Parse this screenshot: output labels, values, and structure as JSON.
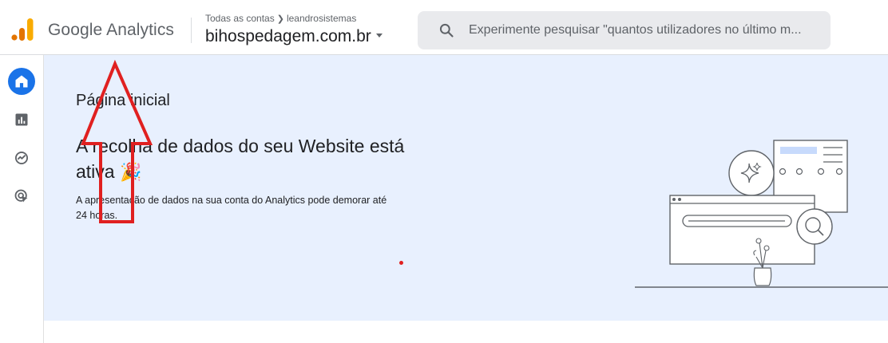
{
  "header": {
    "product_name": "Google Analytics",
    "breadcrumb": {
      "all_accounts": "Todas as contas",
      "account": "leandrosistemas"
    },
    "property_name": "bihospedagem.com.br",
    "search_placeholder": "Experimente pesquisar \"quantos utilizadores no último m..."
  },
  "left_nav": [
    {
      "name": "home",
      "icon": "home-icon",
      "active": true
    },
    {
      "name": "reports",
      "icon": "bar-chart-icon",
      "active": false
    },
    {
      "name": "explore",
      "icon": "explore-icon",
      "active": false
    },
    {
      "name": "advertising",
      "icon": "advertising-icon",
      "active": false
    }
  ],
  "main": {
    "page_title": "Página inicial",
    "headline": "A recolha de dados do seu Website está ativa",
    "headline_emoji": "🎉",
    "subtext": "A apresentação de dados na sua conta do Analytics pode demorar até 24 horas."
  },
  "colors": {
    "accent": "#1a73e8",
    "main_background": "#e8f0fe",
    "annotation": "#e02020",
    "logo_orange": "#f9ab00",
    "logo_dark_orange": "#e37400"
  }
}
